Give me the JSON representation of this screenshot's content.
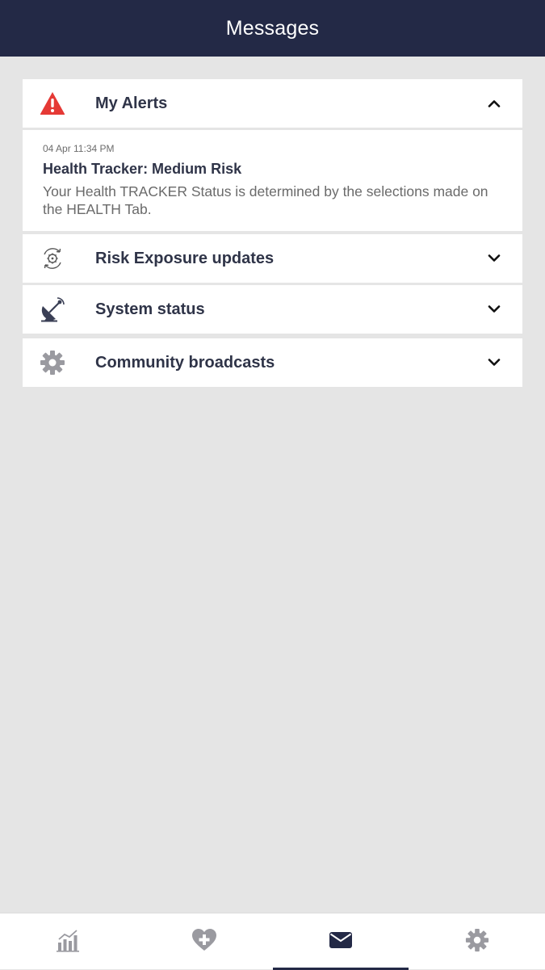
{
  "header": {
    "title": "Messages"
  },
  "sections": [
    {
      "label": "My Alerts",
      "icon": "warning-triangle-icon",
      "expanded": true
    },
    {
      "label": "Risk Exposure updates",
      "icon": "virus-cycle-icon",
      "expanded": false
    },
    {
      "label": "System status",
      "icon": "satellite-dish-icon",
      "expanded": false
    },
    {
      "label": "Community broadcasts",
      "icon": "gear-icon",
      "expanded": false
    }
  ],
  "alerts": [
    {
      "time": "04 Apr 11:34 PM",
      "title": "Health Tracker: Medium Risk",
      "body": "Your Health TRACKER Status is determined by the selections made on the HEALTH Tab."
    }
  ],
  "bottom_nav": [
    {
      "icon": "chart-icon",
      "active": false
    },
    {
      "icon": "heart-plus-icon",
      "active": false
    },
    {
      "icon": "envelope-icon",
      "active": true
    },
    {
      "icon": "gear-icon",
      "active": false
    }
  ],
  "colors": {
    "header_bg": "#232946",
    "alert_red": "#e53935",
    "icon_gray": "#9a9aa0",
    "text_dark": "#2f3448"
  }
}
